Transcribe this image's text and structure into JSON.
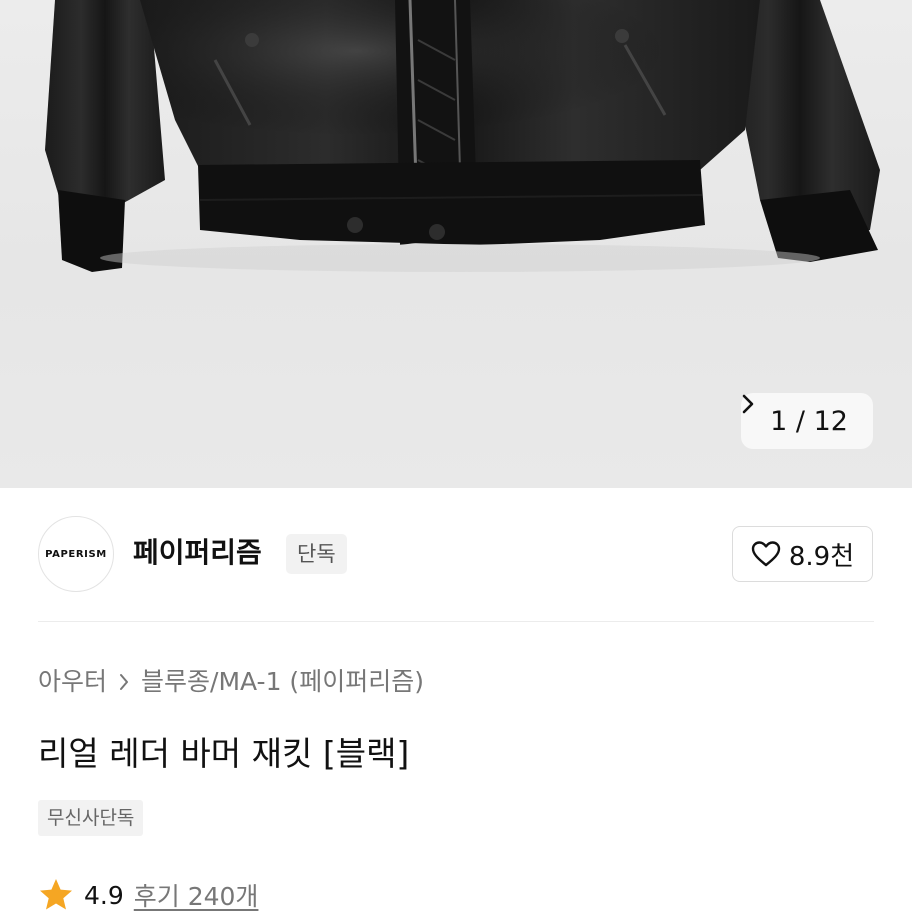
{
  "gallery": {
    "current": "1",
    "separator": "/",
    "total": "12",
    "next_icon": "chevron-right-icon"
  },
  "brand": {
    "logo_text": "PAPERISM",
    "name": "페이퍼리즘",
    "badge": "단독"
  },
  "like": {
    "icon": "heart-outline-icon",
    "count": "8.9천"
  },
  "product": {
    "breadcrumb": [
      "아우터",
      "블루종/MA-1 (페이퍼리즘)"
    ],
    "breadcrumb_separator_icon": "chevron-right-icon",
    "title": "리얼 레더 바머 재킷 [블랙]",
    "tag": "무신사단독"
  },
  "rating": {
    "icon": "star-icon",
    "star_color": "#f5a623",
    "score": "4.9",
    "review_label": "후기 240개"
  }
}
